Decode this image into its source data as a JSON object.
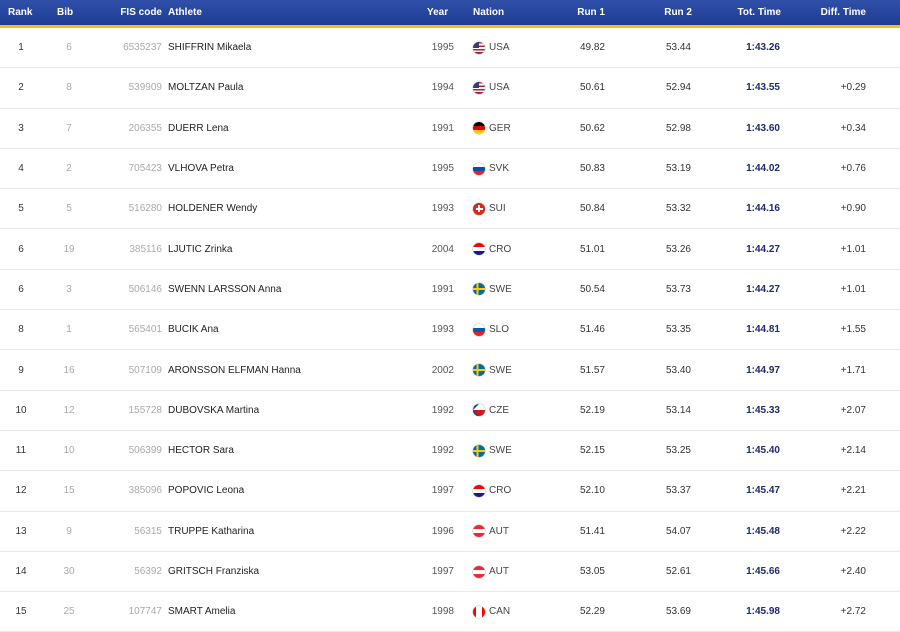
{
  "header": {
    "rank": "Rank",
    "bib": "Bib",
    "fis_code": "FIS code",
    "athlete": "Athlete",
    "year": "Year",
    "nation": "Nation",
    "run1": "Run 1",
    "run2": "Run 2",
    "total_time": "Tot. Time",
    "diff_time": "Diff. Time"
  },
  "flag_colors": {
    "USA": "#b22234",
    "GER": "#dd0000",
    "SVK": "#0b4ea2",
    "SUI": "#d52b1e",
    "CRO": "#171796",
    "SWE": "#006aa7",
    "SLO": "#005da4",
    "CZE": "#d7141a",
    "AUT": "#ed2939",
    "CAN": "#ff0000"
  },
  "rows": [
    {
      "rank": "1",
      "bib": "6",
      "fis": "6535237",
      "athlete": "SHIFFRIN Mikaela",
      "year": "1995",
      "nation": "USA",
      "run1": "49.82",
      "run2": "53.44",
      "total": "1:43.26",
      "diff": ""
    },
    {
      "rank": "2",
      "bib": "8",
      "fis": "539909",
      "athlete": "MOLTZAN Paula",
      "year": "1994",
      "nation": "USA",
      "run1": "50.61",
      "run2": "52.94",
      "total": "1:43.55",
      "diff": "+0.29"
    },
    {
      "rank": "3",
      "bib": "7",
      "fis": "206355",
      "athlete": "DUERR Lena",
      "year": "1991",
      "nation": "GER",
      "run1": "50.62",
      "run2": "52.98",
      "total": "1:43.60",
      "diff": "+0.34"
    },
    {
      "rank": "4",
      "bib": "2",
      "fis": "705423",
      "athlete": "VLHOVA Petra",
      "year": "1995",
      "nation": "SVK",
      "run1": "50.83",
      "run2": "53.19",
      "total": "1:44.02",
      "diff": "+0.76"
    },
    {
      "rank": "5",
      "bib": "5",
      "fis": "516280",
      "athlete": "HOLDENER Wendy",
      "year": "1993",
      "nation": "SUI",
      "run1": "50.84",
      "run2": "53.32",
      "total": "1:44.16",
      "diff": "+0.90"
    },
    {
      "rank": "6",
      "bib": "19",
      "fis": "385116",
      "athlete": "LJUTIC Zrinka",
      "year": "2004",
      "nation": "CRO",
      "run1": "51.01",
      "run2": "53.26",
      "total": "1:44.27",
      "diff": "+1.01"
    },
    {
      "rank": "6",
      "bib": "3",
      "fis": "506146",
      "athlete": "SWENN LARSSON Anna",
      "year": "1991",
      "nation": "SWE",
      "run1": "50.54",
      "run2": "53.73",
      "total": "1:44.27",
      "diff": "+1.01"
    },
    {
      "rank": "8",
      "bib": "1",
      "fis": "565401",
      "athlete": "BUCIK Ana",
      "year": "1993",
      "nation": "SLO",
      "run1": "51.46",
      "run2": "53.35",
      "total": "1:44.81",
      "diff": "+1.55"
    },
    {
      "rank": "9",
      "bib": "16",
      "fis": "507109",
      "athlete": "ARONSSON ELFMAN Hanna",
      "year": "2002",
      "nation": "SWE",
      "run1": "51.57",
      "run2": "53.40",
      "total": "1:44.97",
      "diff": "+1.71"
    },
    {
      "rank": "10",
      "bib": "12",
      "fis": "155728",
      "athlete": "DUBOVSKA Martina",
      "year": "1992",
      "nation": "CZE",
      "run1": "52.19",
      "run2": "53.14",
      "total": "1:45.33",
      "diff": "+2.07"
    },
    {
      "rank": "11",
      "bib": "10",
      "fis": "506399",
      "athlete": "HECTOR Sara",
      "year": "1992",
      "nation": "SWE",
      "run1": "52.15",
      "run2": "53.25",
      "total": "1:45.40",
      "diff": "+2.14"
    },
    {
      "rank": "12",
      "bib": "15",
      "fis": "385096",
      "athlete": "POPOVIC Leona",
      "year": "1997",
      "nation": "CRO",
      "run1": "52.10",
      "run2": "53.37",
      "total": "1:45.47",
      "diff": "+2.21"
    },
    {
      "rank": "13",
      "bib": "9",
      "fis": "56315",
      "athlete": "TRUPPE Katharina",
      "year": "1996",
      "nation": "AUT",
      "run1": "51.41",
      "run2": "54.07",
      "total": "1:45.48",
      "diff": "+2.22"
    },
    {
      "rank": "14",
      "bib": "30",
      "fis": "56392",
      "athlete": "GRITSCH Franziska",
      "year": "1997",
      "nation": "AUT",
      "run1": "53.05",
      "run2": "52.61",
      "total": "1:45.66",
      "diff": "+2.40"
    },
    {
      "rank": "15",
      "bib": "25",
      "fis": "107747",
      "athlete": "SMART Amelia",
      "year": "1998",
      "nation": "CAN",
      "run1": "52.29",
      "run2": "53.69",
      "total": "1:45.98",
      "diff": "+2.72"
    }
  ]
}
